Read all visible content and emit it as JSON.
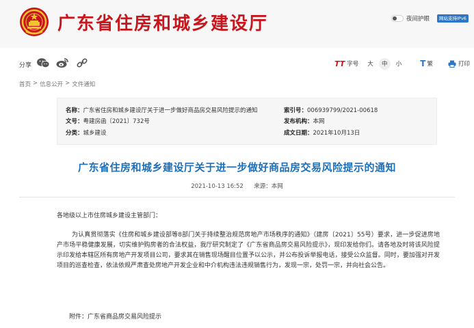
{
  "header": {
    "site_title": "广东省住房和城乡建设厅",
    "night_mode_label": "夜间护眼",
    "ipv6_badge": "网站支持IPv6",
    "colors": {
      "brand": "#c8161d",
      "accent": "#1e6fb8",
      "badge": "#2c78c7"
    }
  },
  "toolbar": {
    "share_label": "分享",
    "share_icons": [
      "wechat-icon",
      "weibo-icon",
      "link-icon"
    ],
    "font_size_label": "字号",
    "size_large": "大",
    "size_medium": "中",
    "size_small": "小",
    "traditional_label": "繁",
    "print_label": "打印"
  },
  "breadcrumb": {
    "items": [
      "首页",
      "信息公开",
      "文件通知"
    ],
    "separator": ">"
  },
  "meta": {
    "name_label": "名称：",
    "name_value": "广东省住房和城乡建设厅关于进一步做好商品房交易风险提示的通知",
    "doc_no_label": "文号：",
    "doc_no_value": "粤建房函〔2021〕732号",
    "category_label": "分类：",
    "category_value": "城乡建设",
    "index_label": "索引号：",
    "index_value": "006939799/2021-00618",
    "issuer_label": "发布机构：",
    "issuer_value": "本网",
    "date_label": "成文日期：",
    "date_value": "2021年10月13日"
  },
  "article": {
    "title": "广东省住房和城乡建设厅关于进一步做好商品房交易风险提示的通知",
    "publish_time": "2021-10-13  16:52",
    "source": "来源：本网",
    "salutation": "各地级以上市住房城乡建设主管部门：",
    "paragraph": "为认真贯彻落实《住房和城乡建设部等8部门关于持续整治规范房地产市场秩序的通知》（建房〔2021〕55号）要求，进一步促进房地产市场平稳健康发展，切实维护购房者的合法权益，我厅研究制定了《广东省商品房交易风险提示》，现印发给你们。请各地及时将该风险提示印发给本辖区所有房地产开发项目公司，要求其在销售现场醒目位置予以公示，并公布投诉举报电话，接受公众监督。同时，要加强对开发项目的巡查检查，依法依规严肃查处房地产开发企业和中介机构违法违规销售行为，发现一宗，处罚一宗，并向社会公告。",
    "attachment": "附件：广东省商品房交易风险提示"
  }
}
